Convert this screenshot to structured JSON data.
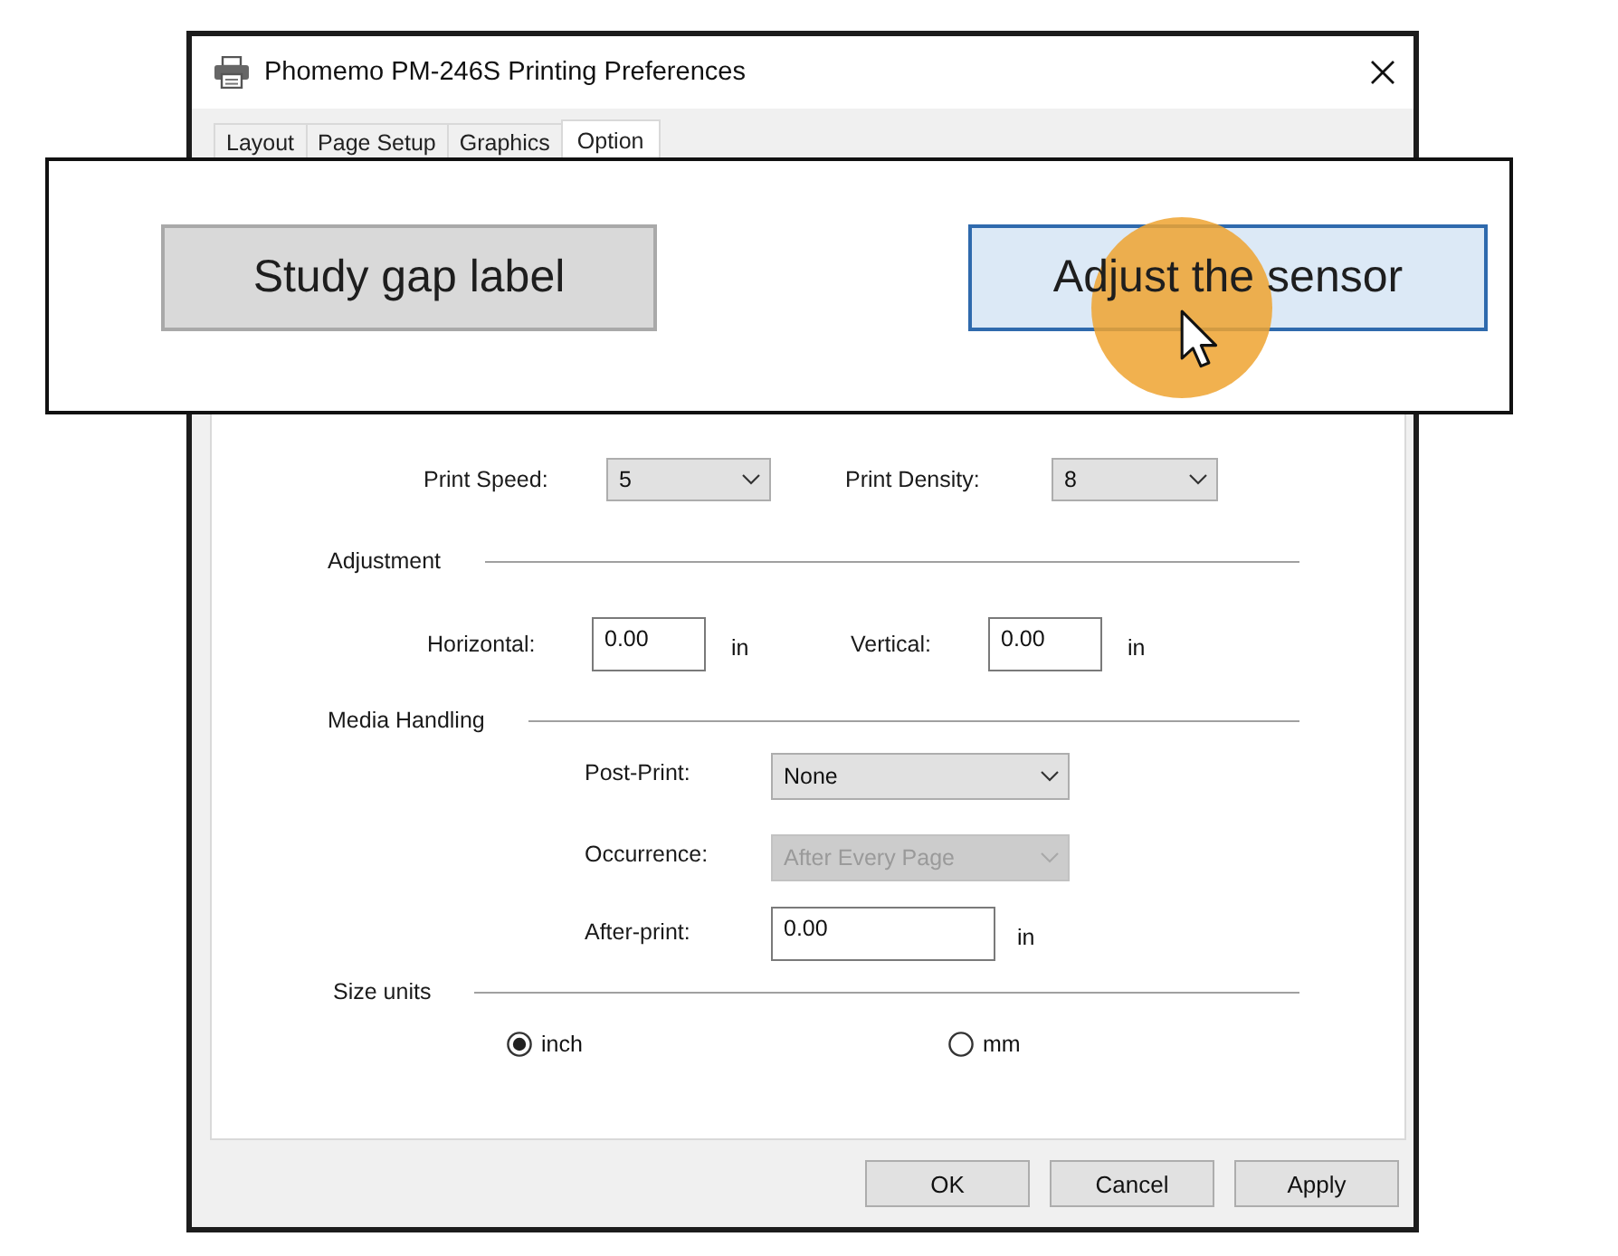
{
  "window": {
    "title": "Phomemo PM-246S Printing Preferences"
  },
  "tabs": [
    {
      "label": "Layout",
      "selected": false
    },
    {
      "label": "Page Setup",
      "selected": false
    },
    {
      "label": "Graphics",
      "selected": false
    },
    {
      "label": "Option",
      "selected": true
    }
  ],
  "callout": {
    "buttons": [
      {
        "label": "Study gap label",
        "hovered": false
      },
      {
        "label": "Adjust the sensor",
        "hovered": true
      }
    ]
  },
  "print_settings": [
    {
      "label": "Print Speed:",
      "value": "5"
    },
    {
      "label": "Print Density:",
      "value": "8"
    }
  ],
  "adjustment": {
    "title": "Adjustment",
    "fields": [
      {
        "label": "Horizontal:",
        "value": "0.00",
        "unit": "in"
      },
      {
        "label": "Vertical:",
        "value": "0.00",
        "unit": "in"
      }
    ]
  },
  "media_handling": {
    "title": "Media Handling",
    "rows": [
      {
        "kind": "dropdown",
        "label": "Post-Print:",
        "value": "None",
        "disabled": false
      },
      {
        "kind": "dropdown",
        "label": "Occurrence:",
        "value": "After Every Page",
        "disabled": true
      },
      {
        "kind": "input",
        "label": "After-print:",
        "value": "0.00",
        "unit": "in"
      }
    ]
  },
  "size_units": {
    "title": "Size units",
    "options": [
      {
        "label": "inch",
        "selected": true
      },
      {
        "label": "mm",
        "selected": false
      }
    ]
  },
  "buttons": [
    "OK",
    "Cancel",
    "Apply"
  ]
}
